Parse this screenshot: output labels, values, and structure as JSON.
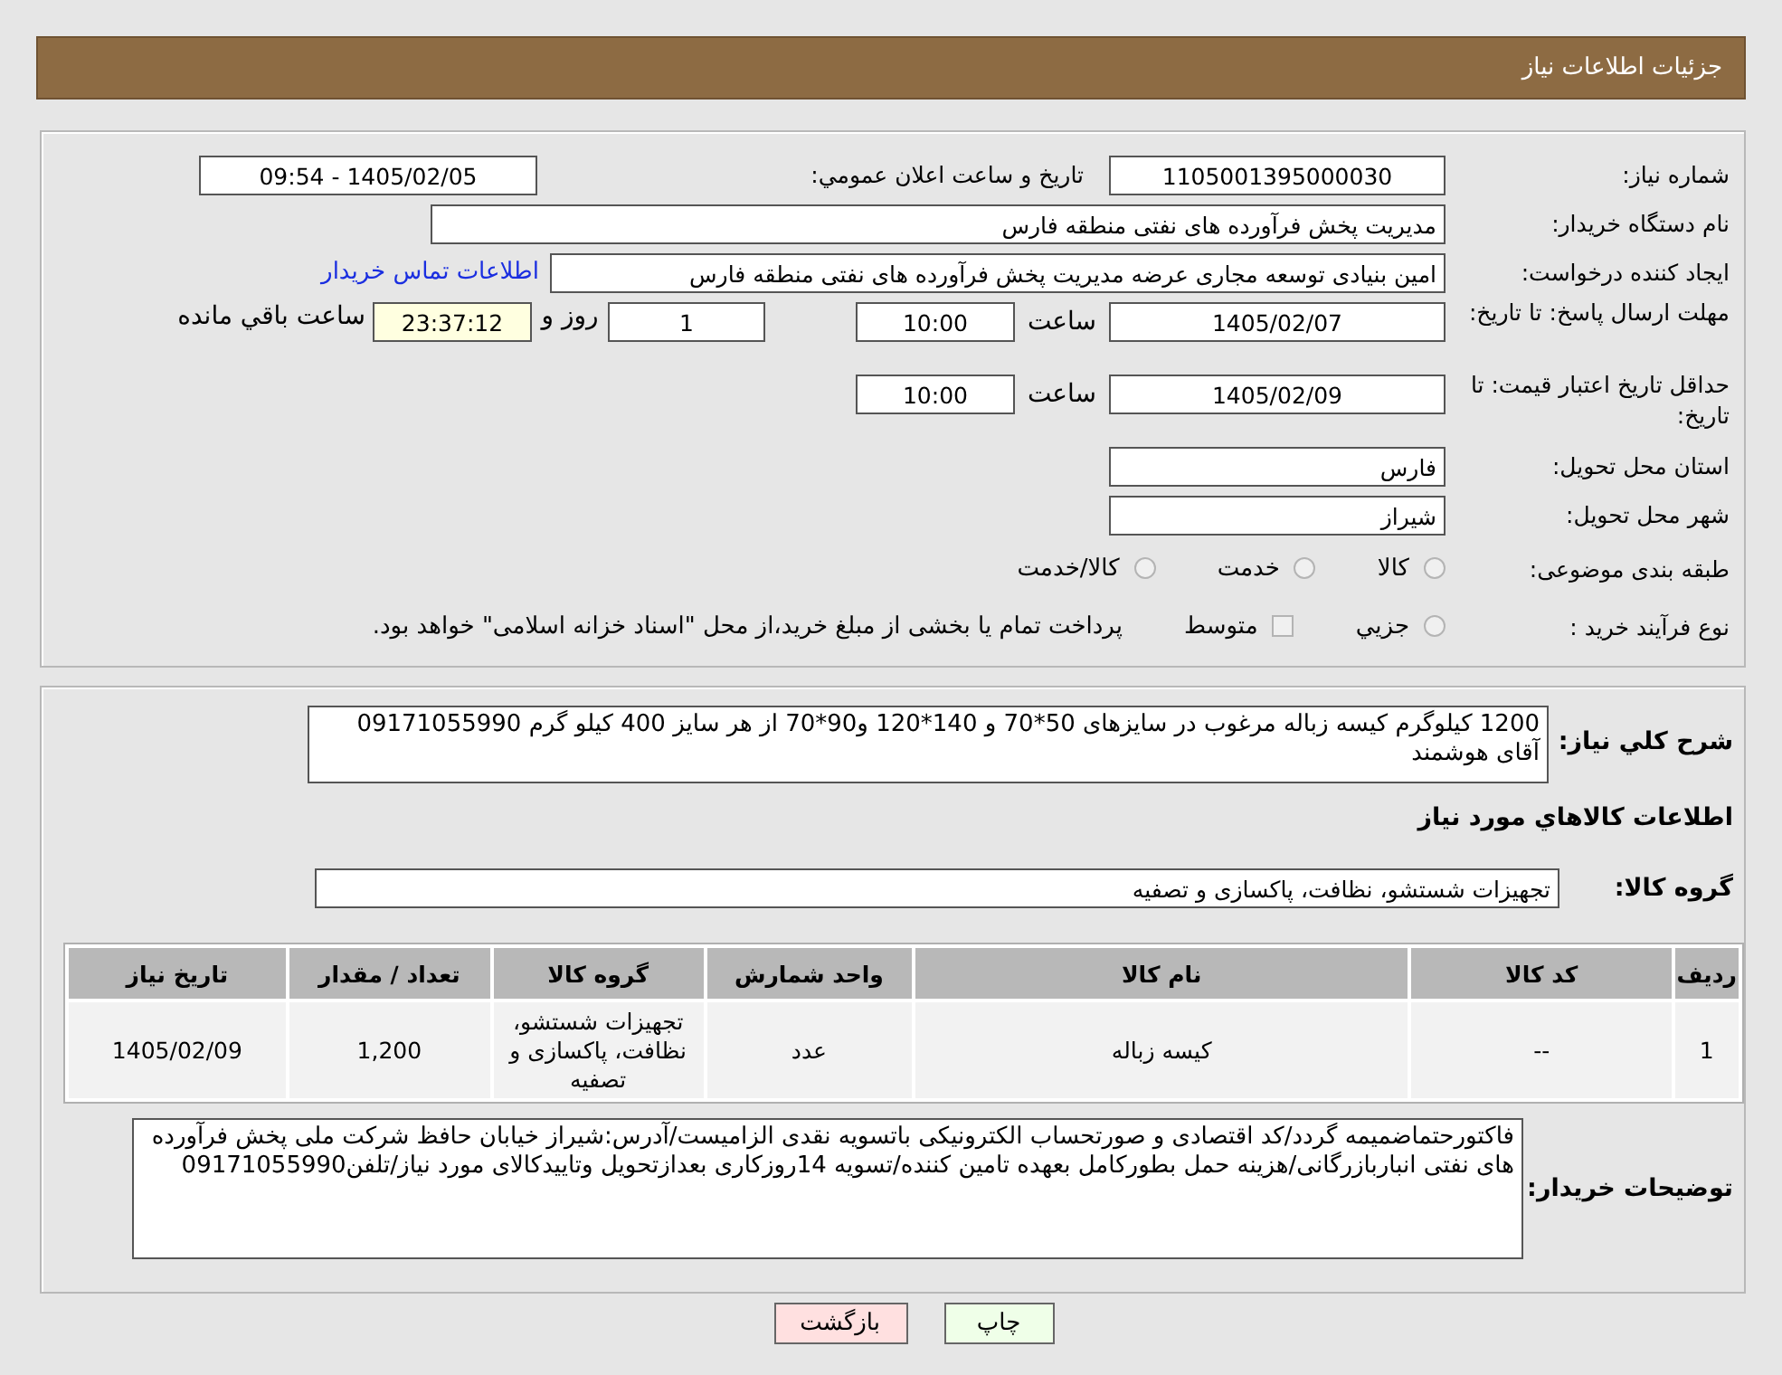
{
  "header": {
    "title": "جزئیات اطلاعات نیاز"
  },
  "details": {
    "need_number": {
      "label": "شماره نیاز:",
      "value": "1105001395000030"
    },
    "announce": {
      "label": "تاریخ و ساعت اعلان عمومي:",
      "value": "1405/02/05 - 09:54"
    },
    "buyer": {
      "label": "نام دستگاه خریدار:",
      "value": "مدیریت پخش فرآورده های نفتی منطقه فارس"
    },
    "requester": {
      "label": "ایجاد کننده درخواست:",
      "value": "امین بنیادی توسعه مجاری عرضه مدیریت پخش فرآورده های نفتی منطقه فارس",
      "link": "اطلاعات تماس خریدار"
    },
    "reply_deadline": {
      "label": "مهلت ارسال پاسخ: تا تاریخ:",
      "date": "1405/02/07",
      "time_label": "ساعت",
      "time": "10:00",
      "days": "1",
      "days_label": "روز و",
      "remaining": "23:37:12",
      "remaining_label": "ساعت باقي مانده"
    },
    "price_validity": {
      "label": "حداقل تاریخ اعتبار قیمت: تا تاریخ:",
      "date": "1405/02/09",
      "time_label": "ساعت",
      "time": "10:00"
    },
    "province": {
      "label": "استان محل تحویل:",
      "value": "فارس"
    },
    "city": {
      "label": "شهر محل تحویل:",
      "value": "شیراز"
    },
    "category": {
      "label": "طبقه بندی موضوعی:",
      "options": [
        {
          "label": "کالا",
          "kind": "radio",
          "selected": false
        },
        {
          "label": "خدمت",
          "kind": "radio",
          "selected": false
        },
        {
          "label": "کالا/خدمت",
          "kind": "radio",
          "selected": false
        }
      ]
    },
    "process": {
      "label": "نوع فرآیند خرید :",
      "options": [
        {
          "label": "جزيي",
          "kind": "radio",
          "selected": false
        },
        {
          "label": "متوسط",
          "kind": "checkbox",
          "selected": false
        }
      ],
      "note": "پرداخت تمام یا بخشی از مبلغ خرید،از محل \"اسناد خزانه اسلامی\" خواهد بود."
    }
  },
  "needs": {
    "summary_label": "شرح کلي نیاز:",
    "summary": "1200 کیلوگرم کیسه زباله مرغوب در سایزهای 50*70 و 140*120 و90*70 از هر سایز 400 کیلو گرم 09171055990 آقای هوشمند",
    "goods_heading": "اطلاعات کالاهاي مورد نیاز",
    "group_label": "گروه کالا:",
    "group": "تجهیزات شستشو، نظافت، پاکسازی و تصفیه",
    "table": {
      "columns": [
        "ردیف",
        "کد کالا",
        "نام کالا",
        "واحد شمارش",
        "گروه کالا",
        "تعداد / مقدار",
        "تاریخ نیاز"
      ],
      "rows": [
        [
          "1",
          "--",
          "کیسه زباله",
          "عدد",
          "تجهیزات شستشو، نظافت، پاکسازی و تصفیه",
          "1,200",
          "1405/02/09"
        ]
      ]
    },
    "buyer_notes_label": "توضیحات خریدار:",
    "buyer_notes": "فاکتورحتماضمیمه گردد/کد اقتصادی و صورتحساب الکترونیکی باتسویه نقدی الزامیست/آدرس:شیراز خیابان حافظ شرکت ملی پخش فرآورده های نفتی انباربازرگانی/هزینه حمل بطورکامل بعهده تامین کننده/تسویه 14روزکاری بعدازتحویل وتاییدکالای مورد نیاز/تلفن09171055990"
  },
  "buttons": [
    {
      "label": "چاپ",
      "kind": "print"
    },
    {
      "label": "بازگشت",
      "kind": "back"
    }
  ]
}
